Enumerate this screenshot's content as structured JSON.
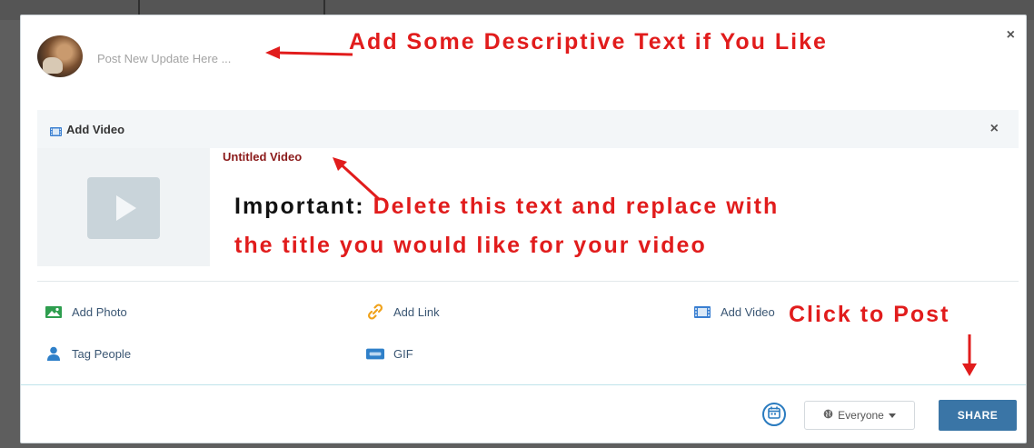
{
  "composer": {
    "placeholder": "Post New Update Here ...",
    "close_label": "×"
  },
  "video_attachment": {
    "header_label": "Add Video",
    "close_label": "×",
    "video_title": "Untitled Video"
  },
  "actions": [
    {
      "label": "Add Photo",
      "icon": "image-icon",
      "color": "#2e9e4f"
    },
    {
      "label": "Add Link",
      "icon": "link-icon",
      "color": "#f0a21b"
    },
    {
      "label": "Add Video",
      "icon": "film-icon",
      "color": "#3a7fd1"
    },
    {
      "label": "Tag People",
      "icon": "person-icon",
      "color": "#2f80c9"
    },
    {
      "label": "GIF",
      "icon": "gif-icon",
      "color": "#2f80c9"
    }
  ],
  "footer": {
    "audience_label": "Everyone",
    "share_label": "SHARE"
  },
  "annotations": {
    "descriptive": "Add Some Descriptive Text if You Like",
    "important_lead": "Important:",
    "important_rest": "Delete this text and replace with",
    "important_line2": "the title you would like for your video",
    "click_to_post": "Click to Post"
  },
  "colors": {
    "annotation": "#e11c1c",
    "share": "#3a75a6",
    "link_text": "#3a5673"
  }
}
